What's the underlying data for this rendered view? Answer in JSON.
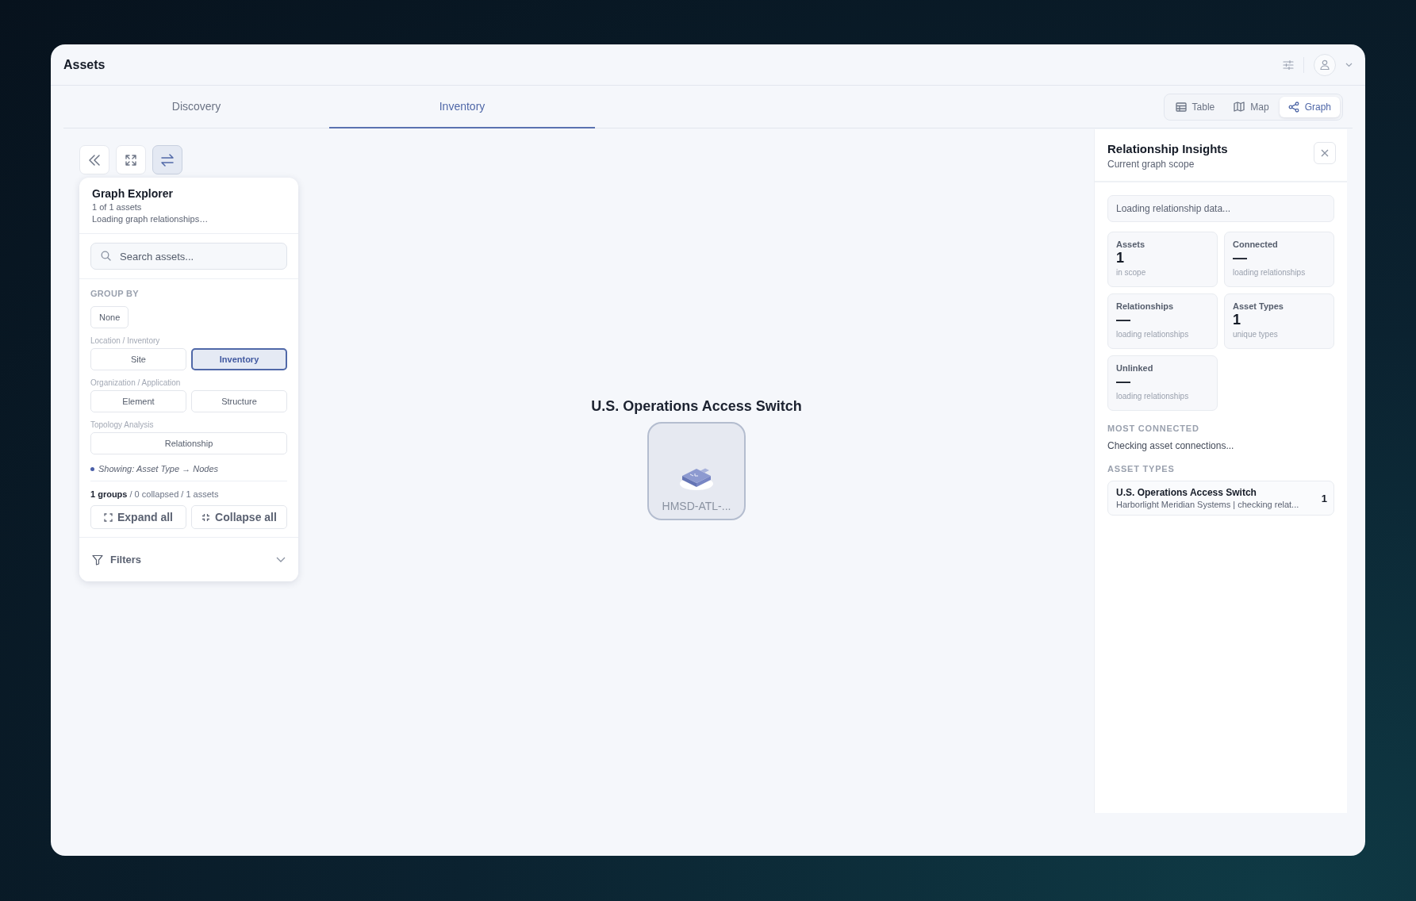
{
  "window": {
    "title": "Assets"
  },
  "tabs": [
    {
      "label": "Discovery",
      "selected": false
    },
    {
      "label": "Inventory",
      "selected": true
    }
  ],
  "view_modes": [
    {
      "kind": "table",
      "label": "Table",
      "selected": false
    },
    {
      "kind": "map",
      "label": "Map",
      "selected": false
    },
    {
      "kind": "graph",
      "label": "Graph",
      "selected": true
    }
  ],
  "canvas_tools": [
    {
      "kind": "collapse",
      "selected": false
    },
    {
      "kind": "fullscreen",
      "selected": false
    },
    {
      "kind": "swap",
      "selected": true
    }
  ],
  "explorer": {
    "title": "Graph Explorer",
    "count": "1 of 1 assets",
    "status": "Loading graph relationships…",
    "search": {
      "placeholder": "Search assets..."
    },
    "group_by": "GROUP BY",
    "none_option": {
      "label": "None",
      "selected": false
    },
    "groups": [
      {
        "heading": "Location / Inventory",
        "options": [
          {
            "label": "Site",
            "selected": false
          },
          {
            "label": "Inventory",
            "selected": true
          }
        ]
      },
      {
        "heading": "Organization / Application",
        "options": [
          {
            "label": "Element",
            "selected": false
          },
          {
            "label": "Structure",
            "selected": false
          }
        ]
      },
      {
        "heading": "Topology Analysis",
        "options": [
          {
            "label": "Relationship",
            "selected": false
          }
        ]
      }
    ],
    "showing": "Showing: Asset Type → Nodes",
    "summary": "**1 groups** / 0 collapsed / 1 assets",
    "actions": [
      {
        "kind": "expand",
        "label": "Expand all"
      },
      {
        "kind": "collapse",
        "label": "Collapse all"
      }
    ],
    "filters": {
      "label": "Filters",
      "expanded": false
    }
  },
  "graph": {
    "group_title": "U.S. Operations Access Switch",
    "node_label": "HMSD-ATL-..."
  },
  "insights": {
    "title": "Relationship Insights",
    "subtitle": "Current graph scope",
    "status": "Loading relationship data...",
    "stats": [
      {
        "label": "Assets",
        "value": "1",
        "note": "in scope"
      },
      {
        "label": "Connected",
        "value": "—",
        "note": "loading relationships"
      },
      {
        "label": "Relationships",
        "value": "—",
        "note": "loading relationships"
      },
      {
        "label": "Asset Types",
        "value": "1",
        "note": "unique types"
      },
      {
        "label": "Unlinked",
        "value": "—",
        "note": "loading relationships"
      }
    ],
    "most_connected": {
      "heading": "MOST CONNECTED",
      "text": "Checking asset connections..."
    },
    "asset_types": {
      "heading": "ASSET TYPES",
      "items": [
        {
          "name": "U.S. Operations Access Switch",
          "detail": "Harborlight Meridian Systems | checking relat...",
          "count": "1"
        }
      ]
    }
  }
}
